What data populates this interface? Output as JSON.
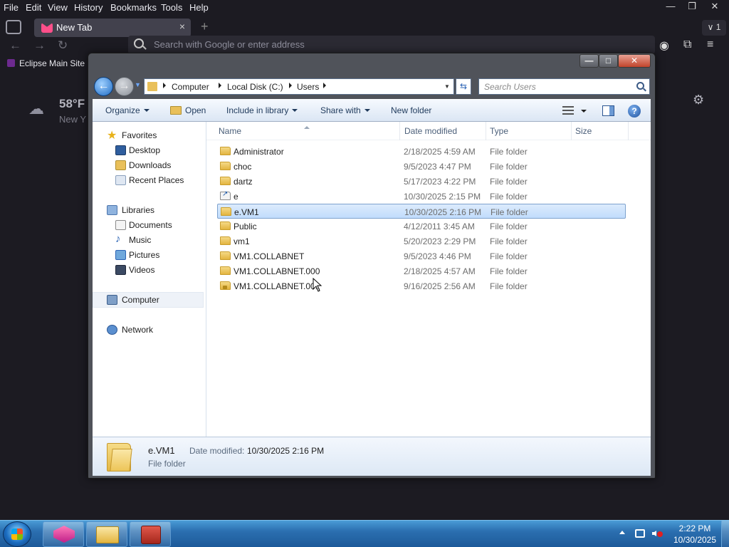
{
  "browser": {
    "menu": [
      "File",
      "Edit",
      "View",
      "History",
      "Bookmarks",
      "Tools",
      "Help"
    ],
    "tab": {
      "title": "New Tab",
      "close": "×"
    },
    "tab_overflow": "1",
    "url_placeholder": "Search with Google or enter address",
    "bookmark": "Eclipse Main Site",
    "weather": {
      "temp": "58°F",
      "location": "New Y"
    }
  },
  "explorer": {
    "window_buttons": {
      "minimize": "—",
      "maximize": "□",
      "close": "✕"
    },
    "breadcrumb": [
      "Computer",
      "Local Disk (C:)",
      "Users"
    ],
    "search_placeholder": "Search Users",
    "commands": {
      "organize": "Organize",
      "open": "Open",
      "include_in_library": "Include in library",
      "share_with": "Share with",
      "new_folder": "New folder",
      "help": "?"
    },
    "nav": {
      "favorites": "Favorites",
      "desktop": "Desktop",
      "downloads": "Downloads",
      "recent_places": "Recent Places",
      "libraries": "Libraries",
      "documents": "Documents",
      "music": "Music",
      "pictures": "Pictures",
      "videos": "Videos",
      "computer": "Computer",
      "network": "Network"
    },
    "columns": {
      "name": "Name",
      "date": "Date modified",
      "type": "Type",
      "size": "Size"
    },
    "files": [
      {
        "name": "Administrator",
        "date": "2/18/2025 4:59 AM",
        "type": "File folder",
        "icon": "folder-icon"
      },
      {
        "name": "choc",
        "date": "9/5/2023 4:47 PM",
        "type": "File folder",
        "icon": "folder-icon"
      },
      {
        "name": "dartz",
        "date": "5/17/2023 4:22 PM",
        "type": "File folder",
        "icon": "folder-icon"
      },
      {
        "name": "e",
        "date": "10/30/2025 2:15 PM",
        "type": "File folder",
        "icon": "shortcut-folder-icon"
      },
      {
        "name": "e.VM1",
        "date": "10/30/2025 2:16 PM",
        "type": "File folder",
        "icon": "folder-icon"
      },
      {
        "name": "Public",
        "date": "4/12/2011 3:45 AM",
        "type": "File folder",
        "icon": "folder-icon"
      },
      {
        "name": "vm1",
        "date": "5/20/2023 2:29 PM",
        "type": "File folder",
        "icon": "folder-icon"
      },
      {
        "name": "VM1.COLLABNET",
        "date": "9/5/2023 4:46 PM",
        "type": "File folder",
        "icon": "folder-icon"
      },
      {
        "name": "VM1.COLLABNET.000",
        "date": "2/18/2025 4:57 AM",
        "type": "File folder",
        "icon": "folder-icon"
      },
      {
        "name": "VM1.COLLABNET.001",
        "date": "9/16/2025 2:56 AM",
        "type": "File folder",
        "icon": "locked-folder-icon"
      }
    ],
    "selected_index": 4,
    "details": {
      "name": "e.VM1",
      "date_label": "Date modified:",
      "date_value": "10/30/2025 2:16 PM",
      "type": "File folder"
    }
  },
  "taskbar": {
    "time": "2:22 PM",
    "date": "10/30/2025"
  },
  "colors": {
    "selection": "#c1dcfc",
    "selection_border": "#7da2ce",
    "taskbar": "#2b6fb0",
    "browser_bg": "#1c1b22"
  }
}
